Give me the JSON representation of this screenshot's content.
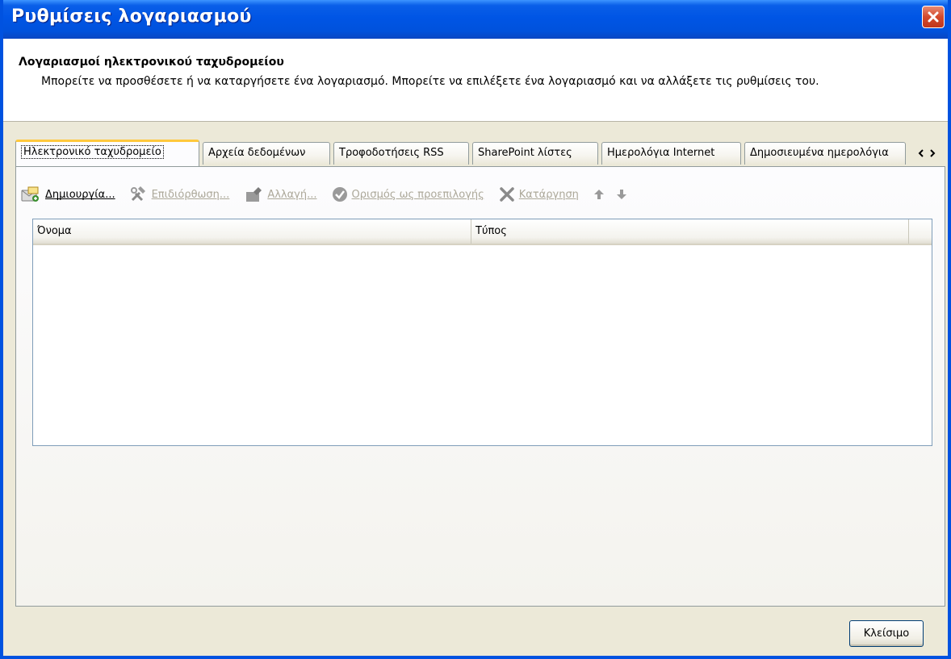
{
  "window": {
    "title": "Ρυθμίσεις λογαριασμού"
  },
  "header": {
    "title": "Λογαριασμοί ηλεκτρονικού ταχυδρομείου",
    "description": "Μπορείτε να προσθέσετε ή να καταργήσετε ένα λογαριασμό. Μπορείτε να επιλέξετε ένα λογαριασμό και να αλλάξετε τις ρυθμίσεις του."
  },
  "tabs": [
    {
      "label": "Ηλεκτρονικό ταχυδρομείο",
      "active": true
    },
    {
      "label": "Αρχεία δεδομένων"
    },
    {
      "label": "Τροφοδοτήσεις RSS"
    },
    {
      "label": "SharePoint λίστες"
    },
    {
      "label": "Ημερολόγια Internet"
    },
    {
      "label": "Δημοσιευμένα ημερολόγια"
    }
  ],
  "toolbar": {
    "new_label": "Δημιουργία...",
    "repair_label": "Επιδιόρθωση...",
    "change_label": "Αλλαγή...",
    "default_label": "Ορισμός ως προεπιλογής",
    "remove_label": "Κατάργηση"
  },
  "list": {
    "columns": [
      "Όνομα",
      "Τύπος"
    ],
    "rows": []
  },
  "footer": {
    "close_label": "Κλείσιμο"
  }
}
